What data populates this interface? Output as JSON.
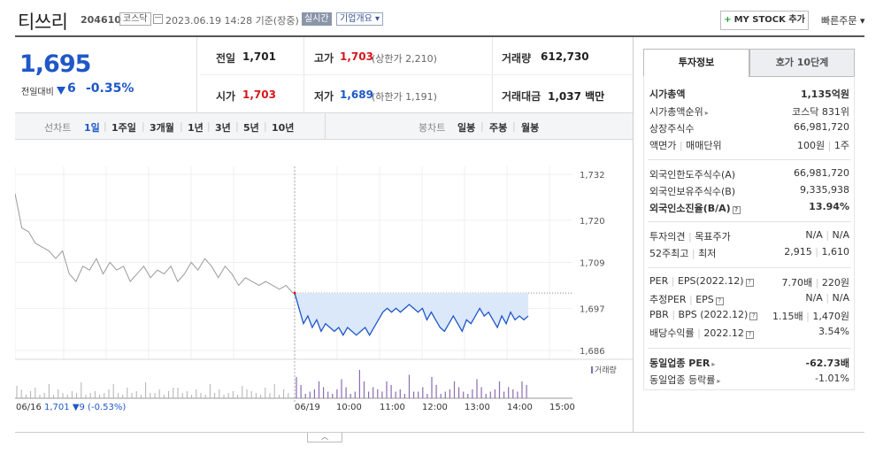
{
  "header": {
    "title": "티쓰리",
    "code": "204610",
    "market": "코스닥",
    "datetime": "2023.06.19 14:28 기준(장중)",
    "realtime": "실시간",
    "company_overview": "기업개요 ▾",
    "mystock": "MY STOCK 추가",
    "quick_order": "빠른주문 ▾"
  },
  "price": {
    "current": "1,695",
    "prev_label": "전일대비",
    "change": "6",
    "change_pct": "-0.35%"
  },
  "quote": {
    "prev_close_label": "전일",
    "prev_close": "1,701",
    "high_label": "고가",
    "high": "1,703",
    "upper_limit": "(상한가 2,210)",
    "volume_label": "거래량",
    "volume": "612,730",
    "open_label": "시가",
    "open": "1,703",
    "low_label": "저가",
    "low": "1,689",
    "lower_limit": "(하한가 1,191)",
    "amount_label": "거래대금",
    "amount": "1,037 백만"
  },
  "period_bar": {
    "line_label": "선차트",
    "periods": [
      "1일",
      "1주일",
      "3개월",
      "1년",
      "3년",
      "5년",
      "10년"
    ],
    "active_period": "1일",
    "candle_label": "봉차트",
    "candles": [
      "일봉",
      "주봉",
      "월봉"
    ]
  },
  "chart_data": {
    "type": "line",
    "yticks": [
      "1,732",
      "1,720",
      "1,709",
      "1,697",
      "1,686"
    ],
    "xticks": [
      "06/19",
      "10:00",
      "11:00",
      "12:00",
      "13:00",
      "14:00",
      "15:00"
    ],
    "prev_date": "06/16",
    "prev_close_info": "1,701 ▼9 (-0.53%)",
    "prev_close_line": 1701,
    "ylim": [
      1686,
      1732
    ],
    "volume_label": "거래량",
    "series": [
      {
        "color": "#9a9a9a",
        "y": [
          1727,
          1718,
          1717,
          1714,
          1713,
          1712,
          1710,
          1712,
          1706,
          1704,
          1708,
          1707,
          1710,
          1706,
          1709,
          1707,
          1708,
          1704,
          1706,
          1708,
          1705,
          1707,
          1706,
          1708,
          1704,
          1706,
          1709,
          1707,
          1710,
          1708,
          1705,
          1708,
          1706,
          1703,
          1705,
          1704,
          1703,
          1704,
          1703,
          1702,
          1703,
          1701
        ]
      },
      {
        "color": "#1e57c8",
        "y": [
          1701,
          1697,
          1693,
          1695,
          1692,
          1694,
          1691,
          1693,
          1692,
          1691,
          1692,
          1690,
          1692,
          1691,
          1690,
          1691,
          1692,
          1690,
          1692,
          1694,
          1696,
          1697,
          1696,
          1697,
          1696,
          1697,
          1698,
          1697,
          1696,
          1697,
          1694,
          1696,
          1694,
          1692,
          1691,
          1693,
          1695,
          1693,
          1691,
          1694,
          1693,
          1695,
          1697,
          1695,
          1696,
          1694,
          1692,
          1695,
          1693,
          1696,
          1694,
          1695,
          1694,
          1695
        ]
      }
    ]
  },
  "invest": {
    "tab_active": "투자정보",
    "tab_inactive": "호가 10단계",
    "market_cap_label": "시가총액",
    "market_cap": "1,135억원",
    "rank_label": "시가총액순위",
    "rank": "코스닥 831위",
    "shares_label": "상장주식수",
    "shares": "66,981,720",
    "par_label": "액면가",
    "unit_label": "매매단위",
    "par": "100원",
    "unit": "1주",
    "foreign_limit_label": "외국인한도주식수(A)",
    "foreign_limit": "66,981,720",
    "foreign_hold_label": "외국인보유주식수(B)",
    "foreign_hold": "9,335,938",
    "foreign_ratio_label": "외국인소진율(B/A)",
    "foreign_ratio": "13.94%",
    "opinion_label": "투자의견",
    "target_label": "목표주가",
    "opinion": "N/A",
    "target": "N/A",
    "high52_label": "52주최고",
    "low52_label": "최저",
    "high52": "2,915",
    "low52": "1,610",
    "per_label": "PER",
    "eps_label": "EPS(2022.12)",
    "per": "7.70배",
    "eps": "220원",
    "est_per_label": "추정PER",
    "est_eps_label": "EPS",
    "est_per": "N/A",
    "est_eps": "N/A",
    "pbr_label": "PBR",
    "bps_label": "BPS (2022.12)",
    "pbr": "1.15배",
    "bps": "1,470원",
    "div_label": "배당수익률",
    "div_date": "2022.12",
    "div": "3.54%",
    "sector_per_label": "동일업종 PER",
    "sector_per": "-62.73배",
    "sector_rate_label": "동일업종 등락률",
    "sector_rate": "-1.01%"
  },
  "colors": {
    "up": "#d6171c",
    "down": "#1e57c8",
    "accent": "#1e57c8"
  }
}
